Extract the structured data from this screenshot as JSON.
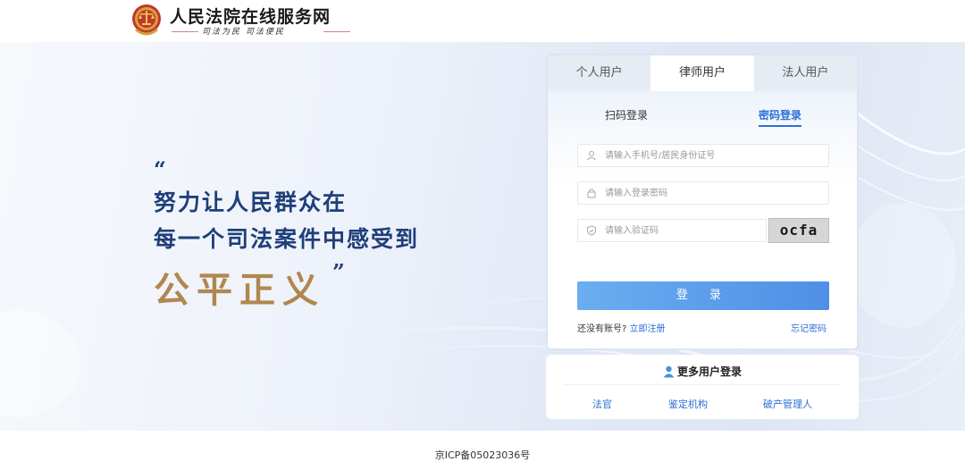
{
  "header": {
    "title": "人民法院在线服务网",
    "slogan": "司法为民  司法便民",
    "logo_icon": "court-emblem-icon"
  },
  "hero": {
    "quote_open": "“",
    "line1": "努力让人民群众在",
    "line2": "每一个司法案件中感受到",
    "emphasis": "公平正义",
    "quote_close": "”"
  },
  "login": {
    "user_tabs": [
      {
        "label": "个人用户",
        "active": false
      },
      {
        "label": "律师用户",
        "active": true
      },
      {
        "label": "法人用户",
        "active": false
      }
    ],
    "mode_tabs": {
      "qr": "扫码登录",
      "password": "密码登录",
      "active": "password"
    },
    "phone_placeholder": "请输入手机号/居民身份证号",
    "password_placeholder": "请输入登录密码",
    "captcha_placeholder": "请输入验证码",
    "captcha_text": "ocfa",
    "submit_label": "登 录",
    "no_account_text": "还没有账号?",
    "register_label": "立即注册",
    "forgot_label": "忘记密码",
    "accent_color": "#2c6fd6"
  },
  "more_users": {
    "title": "更多用户登录",
    "links": [
      "法官",
      "鉴定机构",
      "破产管理人"
    ]
  },
  "footer": {
    "icp": "京ICP备05023036号"
  }
}
